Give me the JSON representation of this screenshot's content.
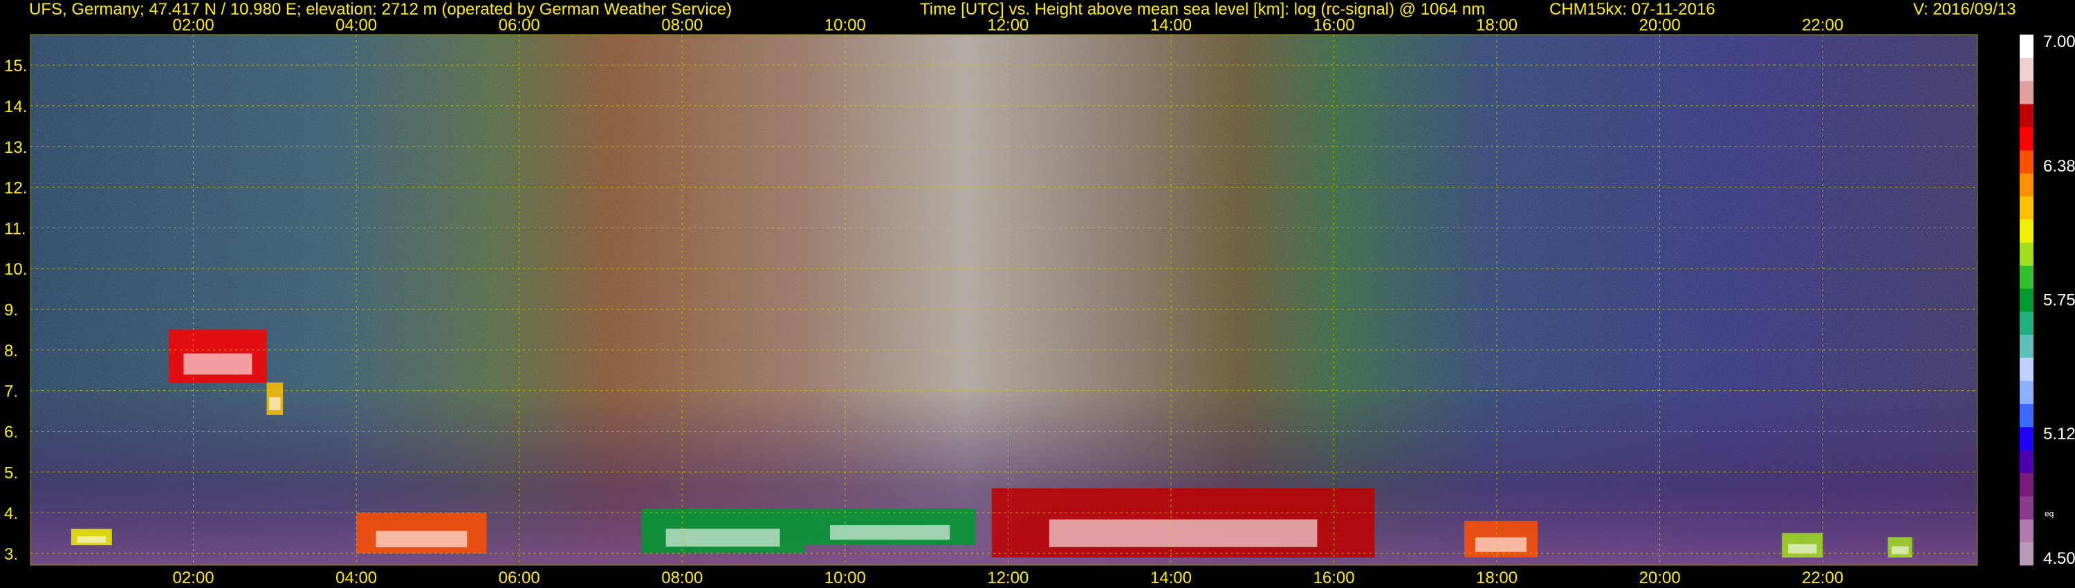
{
  "header": {
    "station": "UFS, Germany; 47.417 N / 10.980 E; elevation: 2712 m  (operated by German Weather Service)",
    "axes_title": "Time [UTC] vs. Height above mean sea level [km]: log (rc-signal) @ 1064 nm",
    "instrument": "CHM15kx: 07-11-2016",
    "version": "V: 2016/09/13"
  },
  "chart_data": {
    "type": "heatmap",
    "x_unit": "hours UTC",
    "xlim": [
      0,
      23.9
    ],
    "ylim": [
      2.71,
      15.75
    ],
    "x_ticks": [
      {
        "value": 2,
        "label": "02:00"
      },
      {
        "value": 4,
        "label": "04:00"
      },
      {
        "value": 6,
        "label": "06:00"
      },
      {
        "value": 8,
        "label": "08:00"
      },
      {
        "value": 10,
        "label": "10:00"
      },
      {
        "value": 12,
        "label": "12:00"
      },
      {
        "value": 14,
        "label": "14:00"
      },
      {
        "value": 16,
        "label": "16:00"
      },
      {
        "value": 18,
        "label": "18:00"
      },
      {
        "value": 20,
        "label": "20:00"
      },
      {
        "value": 22,
        "label": "22:00"
      }
    ],
    "y_ticks": [
      {
        "value": 3,
        "label": "3."
      },
      {
        "value": 4,
        "label": "4."
      },
      {
        "value": 5,
        "label": "5."
      },
      {
        "value": 6,
        "label": "6."
      },
      {
        "value": 7,
        "label": "7."
      },
      {
        "value": 8,
        "label": "8."
      },
      {
        "value": 9,
        "label": "9."
      },
      {
        "value": 10,
        "label": "10."
      },
      {
        "value": 11,
        "label": "11."
      },
      {
        "value": 12,
        "label": "12."
      },
      {
        "value": 13,
        "label": "13."
      },
      {
        "value": 14,
        "label": "14."
      },
      {
        "value": 15,
        "label": "15."
      }
    ],
    "grid": true,
    "colorbar": {
      "range": [
        4.5,
        7.0
      ],
      "labels": [
        {
          "value": 7.0,
          "label": "7.00"
        },
        {
          "value": 6.38,
          "label": "6.38"
        },
        {
          "value": 5.75,
          "label": "5.75"
        },
        {
          "value": 5.12,
          "label": "5.12"
        },
        {
          "value": 4.5,
          "label": "4.50"
        }
      ],
      "extra_label": {
        "value": 4.75,
        "label": "eq"
      },
      "colors_bottom_to_top": [
        "#b89ab8",
        "#b07ab0",
        "#8a3a8a",
        "#7a1a7a",
        "#4a00b0",
        "#2000ff",
        "#3a6aff",
        "#8ab0ff",
        "#c0d0ff",
        "#60c0c0",
        "#20b080",
        "#009a30",
        "#30c030",
        "#a0e020",
        "#f0f000",
        "#ffc000",
        "#ff9000",
        "#ff5000",
        "#ff0000",
        "#c00000",
        "#e0a0a0",
        "#f0d0d0",
        "#ffffff"
      ]
    },
    "cloud_layers": [
      {
        "t0": 1.7,
        "t1": 2.9,
        "y0": 7.2,
        "y1": 8.5,
        "value": 6.5
      },
      {
        "t0": 2.9,
        "t1": 3.1,
        "y0": 6.4,
        "y1": 7.2,
        "value": 6.2
      },
      {
        "t0": 0.5,
        "t1": 1.0,
        "y0": 3.2,
        "y1": 3.6,
        "value": 6.1
      },
      {
        "t0": 4.0,
        "t1": 5.6,
        "y0": 3.0,
        "y1": 4.0,
        "value": 6.4
      },
      {
        "t0": 7.5,
        "t1": 9.5,
        "y0": 3.0,
        "y1": 4.1,
        "value": 5.8
      },
      {
        "t0": 9.5,
        "t1": 11.6,
        "y0": 3.2,
        "y1": 4.1,
        "value": 5.7
      },
      {
        "t0": 11.8,
        "t1": 16.5,
        "y0": 2.9,
        "y1": 4.6,
        "value": 6.6
      },
      {
        "t0": 17.6,
        "t1": 18.5,
        "y0": 2.9,
        "y1": 3.8,
        "value": 6.4
      },
      {
        "t0": 21.5,
        "t1": 22.0,
        "y0": 2.9,
        "y1": 3.5,
        "value": 6.0
      },
      {
        "t0": 22.8,
        "t1": 23.1,
        "y0": 2.9,
        "y1": 3.4,
        "value": 6.0
      }
    ]
  }
}
